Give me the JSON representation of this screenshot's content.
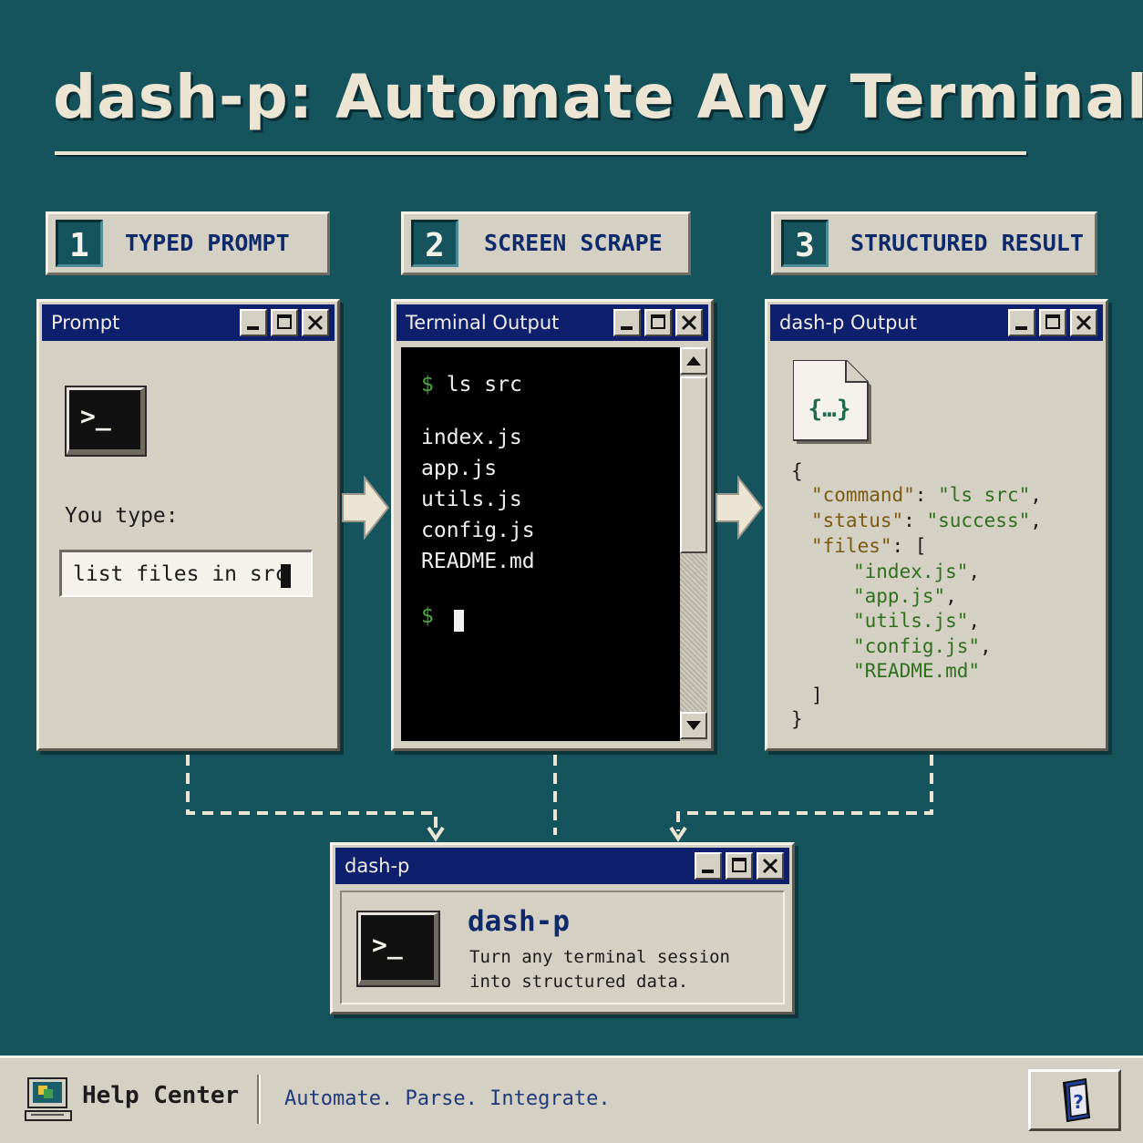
{
  "title": "dash-p: Automate Any Terminal",
  "steps": [
    {
      "num": "1",
      "label": "TYPED PROMPT"
    },
    {
      "num": "2",
      "label": "SCREEN SCRAPE"
    },
    {
      "num": "3",
      "label": "STRUCTURED RESULT"
    }
  ],
  "prompt_window": {
    "title": "Prompt",
    "icon_glyph": ">_",
    "label": "You type:",
    "input_value": "list files in src"
  },
  "terminal_window": {
    "title": "Terminal Output",
    "prompt_symbol": "$",
    "command": "ls src",
    "output": [
      "index.js",
      "app.js",
      "utils.js",
      "config.js",
      "README.md"
    ]
  },
  "output_window": {
    "title": "dash-p Output",
    "file_icon_glyph": "{…}",
    "open_brace": "{",
    "command_key": "\"command\"",
    "command_value": "\"ls src\"",
    "status_key": "\"status\"",
    "status_value": "\"success\"",
    "files_key": "\"files\"",
    "files": [
      "\"index.js\"",
      "\"app.js\"",
      "\"utils.js\"",
      "\"config.js\"",
      "\"README.md\""
    ],
    "close_bracket": "]",
    "close_brace": "}"
  },
  "dashp_window": {
    "title": "dash-p",
    "icon_glyph": ">_",
    "app_name": "dash-p",
    "desc_line1": "Turn any terminal session",
    "desc_line2": "into structured data."
  },
  "taskbar": {
    "help_label": "Help Center",
    "tagline": "Automate. Parse. Integrate.",
    "help_button_glyph": "?"
  },
  "colors": {
    "background": "#15545c",
    "titlebar": "#0e1f6e",
    "panel": "#d4d0c4",
    "terminal_green": "#4aa83c"
  }
}
